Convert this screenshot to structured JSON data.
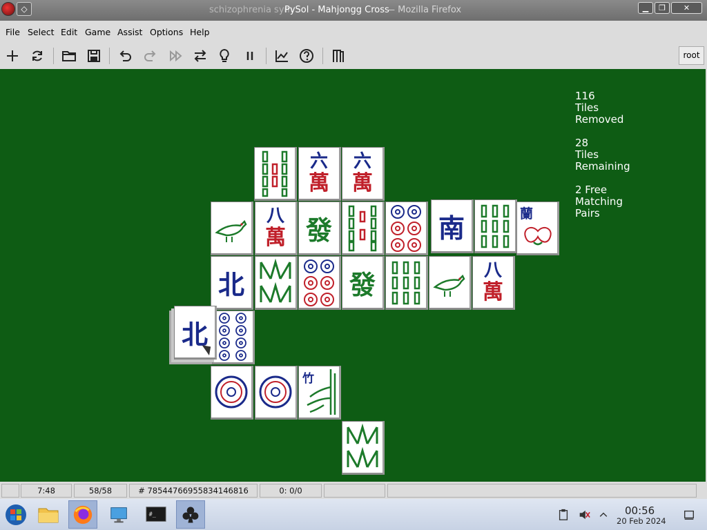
{
  "window": {
    "ghost_text": "schizophrenia sym",
    "title": "PySol - Mahjongg Cross",
    "suffix": "— Mozilla Firefox"
  },
  "menu": [
    "File",
    "Select",
    "Edit",
    "Game",
    "Assist",
    "Options",
    "Help"
  ],
  "toolbar": {
    "buttons": [
      "new-game",
      "restart",
      "open",
      "save",
      "undo",
      "redo",
      "autodrop",
      "shuffle",
      "hint",
      "pause",
      "statistics",
      "rules",
      "quit"
    ],
    "user_label": "root"
  },
  "stats": {
    "removed_count": "116",
    "removed_label_1": "Tiles",
    "removed_label_2": "Removed",
    "remaining_count": "28",
    "remaining_label_1": "Tiles",
    "remaining_label_2": "Remaining",
    "pairs_count": "2 Free",
    "pairs_label_1": "Matching",
    "pairs_label_2": "Pairs"
  },
  "tiles": {
    "char_six": [
      "六",
      "萬"
    ],
    "char_eight": [
      "八",
      "萬"
    ],
    "green_dragon": "發",
    "north_wind": "北",
    "south_wind": "南",
    "orchid": "蘭",
    "bamboo_flower": "竹",
    "colors": {
      "red": "#c0202a",
      "green": "#1c7a2a",
      "blue": "#1a2a8a"
    }
  },
  "status": {
    "time": "7:48",
    "moves": "58/58",
    "game_number": "# 78544766955834146816",
    "score": "0: 0/0"
  },
  "taskbar": {
    "clock_time": "00:56",
    "clock_date": "20 Feb 2024"
  }
}
